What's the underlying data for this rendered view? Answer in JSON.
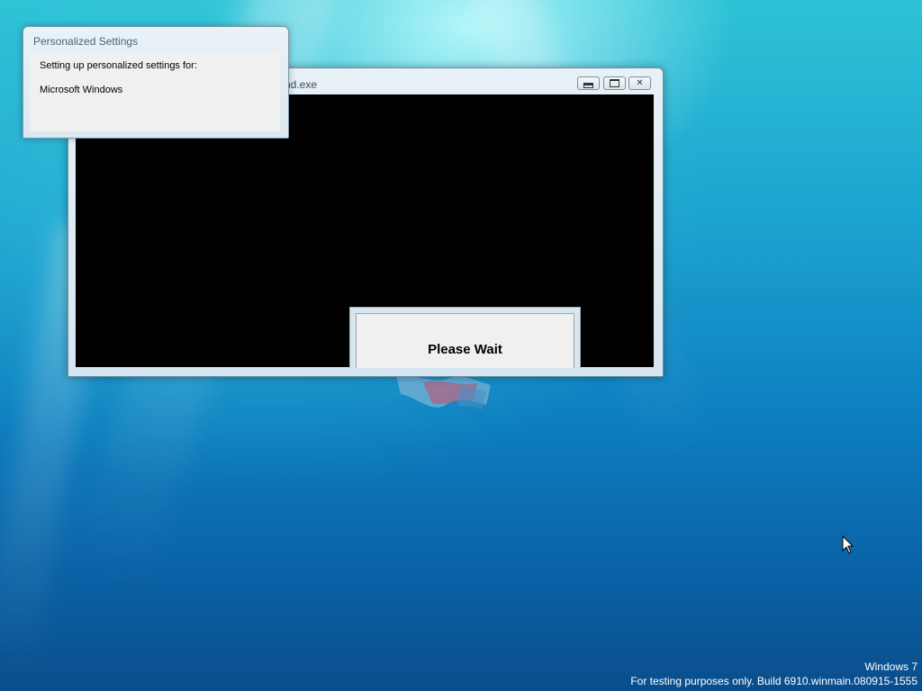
{
  "console_window": {
    "title": "nd.exe"
  },
  "wait_dialog": {
    "message": "Please Wait"
  },
  "settings_window": {
    "title": "Personalized Settings",
    "line1": "Setting up personalized settings for:",
    "line2": "Microsoft Windows"
  },
  "watermark": {
    "line1": "Windows  7",
    "line2": "For testing purposes only. Build 6910.winmain.080915-1555"
  },
  "colors": {
    "desktop_top": "#2ec3d6",
    "desktop_bottom": "#0a4e8c",
    "console_bg": "#000000"
  }
}
